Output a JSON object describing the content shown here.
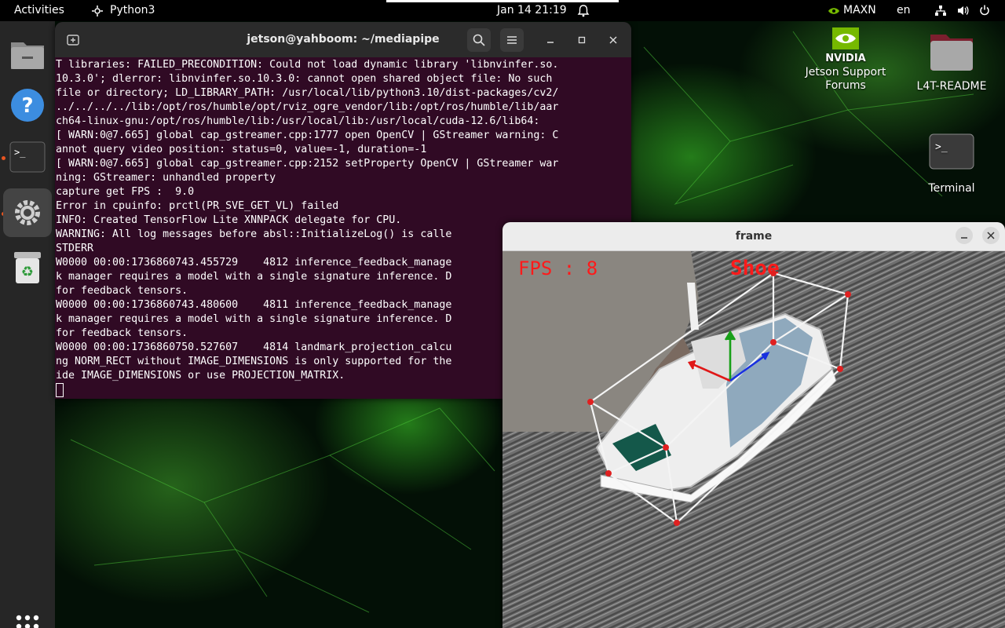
{
  "topbar": {
    "activities": "Activities",
    "app_name": "Python3",
    "clock": "Jan 14  21:19",
    "power_mode": "MAXN",
    "language": "en"
  },
  "dock": {
    "items": [
      "files-icon",
      "help-icon",
      "terminal-icon",
      "settings-icon",
      "trash-icon"
    ],
    "show_apps": "app-grid-icon"
  },
  "desktop": {
    "icons": [
      {
        "label_line1": "Jetson Support",
        "label_line2": "Forums",
        "logo_text": "NVIDIA"
      },
      {
        "label": "L4T-README"
      },
      {
        "label": "Terminal"
      }
    ]
  },
  "terminal": {
    "title": "jetson@yahboom: ~/mediapipe",
    "lines": [
      "T libraries: FAILED_PRECONDITION: Could not load dynamic library 'libnvinfer.so.",
      "10.3.0'; dlerror: libnvinfer.so.10.3.0: cannot open shared object file: No such",
      "file or directory; LD_LIBRARY_PATH: /usr/local/lib/python3.10/dist-packages/cv2/",
      "../../../../lib:/opt/ros/humble/opt/rviz_ogre_vendor/lib:/opt/ros/humble/lib/aar",
      "ch64-linux-gnu:/opt/ros/humble/lib:/usr/local/lib:/usr/local/cuda-12.6/lib64:",
      "[ WARN:0@7.665] global cap_gstreamer.cpp:1777 open OpenCV | GStreamer warning: C",
      "annot query video position: status=0, value=-1, duration=-1",
      "[ WARN:0@7.665] global cap_gstreamer.cpp:2152 setProperty OpenCV | GStreamer war",
      "ning: GStreamer: unhandled property",
      "capture get FPS :  9.0",
      "Error in cpuinfo: prctl(PR_SVE_GET_VL) failed",
      "INFO: Created TensorFlow Lite XNNPACK delegate for CPU.",
      "WARNING: All log messages before absl::InitializeLog() is calle",
      "STDERR",
      "W0000 00:00:1736860743.455729    4812 inference_feedback_manage",
      "k manager requires a model with a single signature inference. D",
      "for feedback tensors.",
      "W0000 00:00:1736860743.480600    4811 inference_feedback_manage",
      "k manager requires a model with a single signature inference. D",
      "for feedback tensors.",
      "W0000 00:00:1736860750.527607    4814 landmark_projection_calcu",
      "ng NORM_RECT without IMAGE_DIMENSIONS is only supported for the",
      "ide IMAGE_DIMENSIONS or use PROJECTION_MATRIX."
    ]
  },
  "frame": {
    "title": "frame",
    "fps_text": "FPS : 8",
    "object_label": "Shoe",
    "overlay_color": "#ff1a1a"
  },
  "colors": {
    "terminal_bg": "#300a24",
    "dock_bg": "#262626",
    "accent": "#e95420",
    "nvidia_green": "#76b900"
  }
}
